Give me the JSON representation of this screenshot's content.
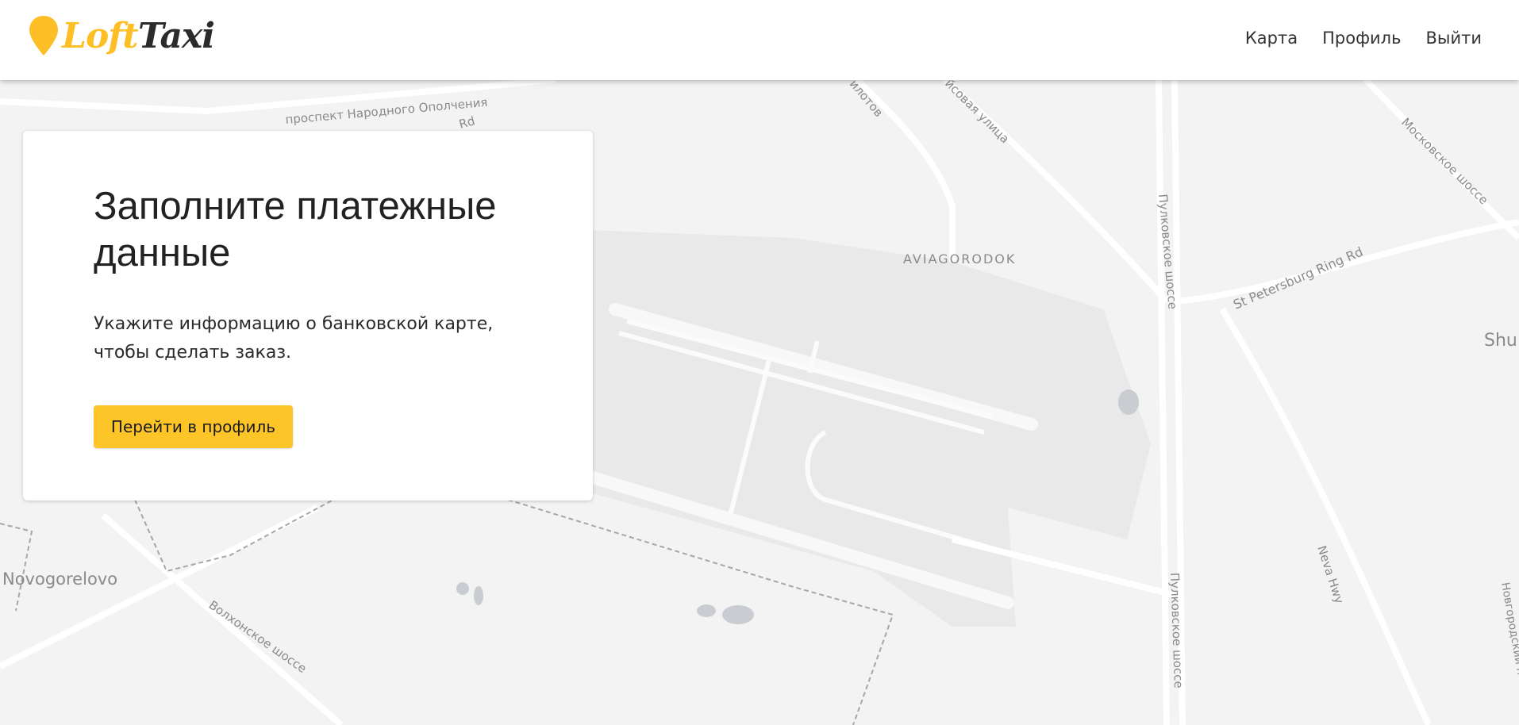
{
  "app": {
    "logo_part1": "Loft",
    "logo_part2": "Taxi",
    "brand_color": "#FDBF25"
  },
  "nav": {
    "items": [
      "Карта",
      "Профиль",
      "Выйти"
    ]
  },
  "card": {
    "title": "Заполните платежные данные",
    "text": "Укажите информацию о банковской карте, чтобы сделать заказ.",
    "button_label": "Перейти в профиль",
    "button_color": "#FDC528"
  },
  "map": {
    "labels": {
      "prospekt": "проспект Народного Ополчения",
      "rd": "Rd",
      "pilotov": "илотов",
      "aerof": "йсовая улица",
      "moskovskoe": "Московское шоссе",
      "pulkovskoe_top": "Пулковское шоссе",
      "aviagorodok": "AVIAGORODOK",
      "ring_rd": "St Petersburg Ring Rd",
      "shu": "Shu",
      "novogorelovo": "Novogorelovo",
      "volkhonskoe": "Волхонское шоссе",
      "neva_hwy": "Neva Hwy",
      "pulkovskoe_bottom": "Пулковское шоссе",
      "novgorodskiy": "Новгородский п"
    }
  }
}
